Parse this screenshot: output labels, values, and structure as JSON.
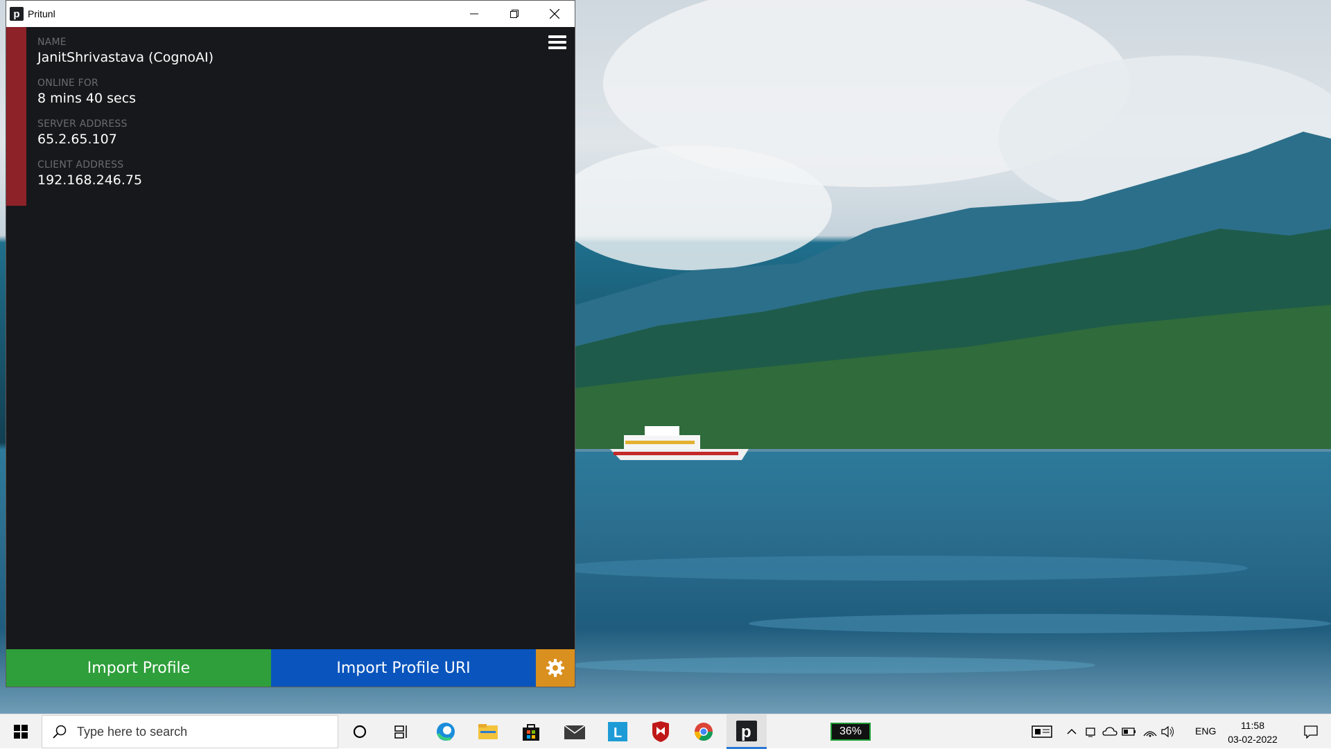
{
  "window": {
    "title": "Pritunl",
    "app_icon_letter": "p",
    "controls": [
      "minimize-icon",
      "restore-icon",
      "close-icon"
    ]
  },
  "profile": {
    "name_label": "NAME",
    "name_value": "JanitShrivastava (CognoAI)",
    "online_label": "ONLINE FOR",
    "online_value": "8 mins 40 secs",
    "server_label": "SERVER ADDRESS",
    "server_value": "65.2.65.107",
    "client_label": "CLIENT ADDRESS",
    "client_value": "192.168.246.75",
    "status_color": "#8e2229"
  },
  "buttons": {
    "import_profile": "Import Profile",
    "import_profile_uri": "Import Profile URI",
    "settings_icon": "gear-icon",
    "menu_icon": "hamburger-menu-icon",
    "import_color": "#2e9f3a",
    "import_uri_color": "#0a55bd",
    "settings_color": "#d9901f"
  },
  "taskbar": {
    "search_placeholder": "Type here to search",
    "apps": [
      "cortana-icon",
      "task-view-icon",
      "edge-icon",
      "file-explorer-icon",
      "store-icon",
      "mail-icon",
      "l-app-icon",
      "mcafee-icon",
      "chrome-icon",
      "pritunl-icon"
    ],
    "battery_percent": "36%",
    "language": "ENG",
    "time": "11:58",
    "date": "03-02-2022"
  }
}
